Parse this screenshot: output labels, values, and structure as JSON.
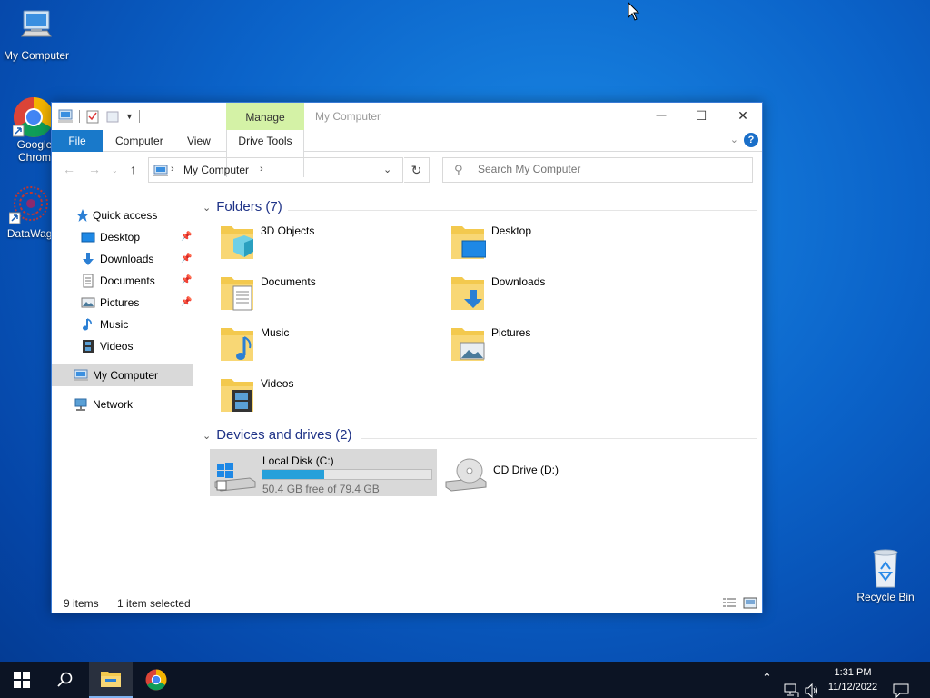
{
  "desktop": {
    "icons": [
      {
        "label": "My Computer",
        "icon": "computer-icon"
      },
      {
        "label": "Google Chrome",
        "label_line1": "Google",
        "label_line2": "Chrom",
        "icon": "chrome-icon"
      },
      {
        "label": "DataWago",
        "icon": "datawago-icon"
      },
      {
        "label": "Recycle Bin",
        "icon": "recycle-bin-icon"
      }
    ]
  },
  "window": {
    "title": "My Computer",
    "context_tab": "Manage",
    "controls": {
      "minimize": "—",
      "maximize": "☐",
      "close": "✕"
    },
    "ribbon_tabs": [
      "File",
      "Computer",
      "View",
      "Drive Tools"
    ],
    "help": "?",
    "address": {
      "path": "My Computer",
      "refresh": "↻"
    },
    "search": {
      "placeholder": "Search My Computer"
    }
  },
  "nav": {
    "quick_access": "Quick access",
    "items": [
      {
        "label": "Desktop",
        "pinned": true
      },
      {
        "label": "Downloads",
        "pinned": true
      },
      {
        "label": "Documents",
        "pinned": true
      },
      {
        "label": "Pictures",
        "pinned": true
      },
      {
        "label": "Music",
        "pinned": false
      },
      {
        "label": "Videos",
        "pinned": false
      }
    ],
    "my_computer": "My Computer",
    "network": "Network"
  },
  "content": {
    "folders_header": "Folders (7)",
    "folders": [
      "3D Objects",
      "Desktop",
      "Documents",
      "Downloads",
      "Music",
      "Pictures",
      "Videos"
    ],
    "drives_header": "Devices and drives (2)",
    "drives": [
      {
        "label": "Local Disk (C:)",
        "free": "50.4 GB free of 79.4 GB",
        "used_fraction": 0.365
      },
      {
        "label": "CD Drive (D:)"
      }
    ]
  },
  "status": {
    "items": "9 items",
    "selected": "1 item selected"
  },
  "taskbar": {
    "time": "1:31 PM",
    "date": "11/12/2022"
  },
  "colors": {
    "accent": "#1979ca",
    "manage_tab": "#d4f2a6",
    "taskbar": "#0c1424",
    "drive_fill": "#26a0da"
  }
}
